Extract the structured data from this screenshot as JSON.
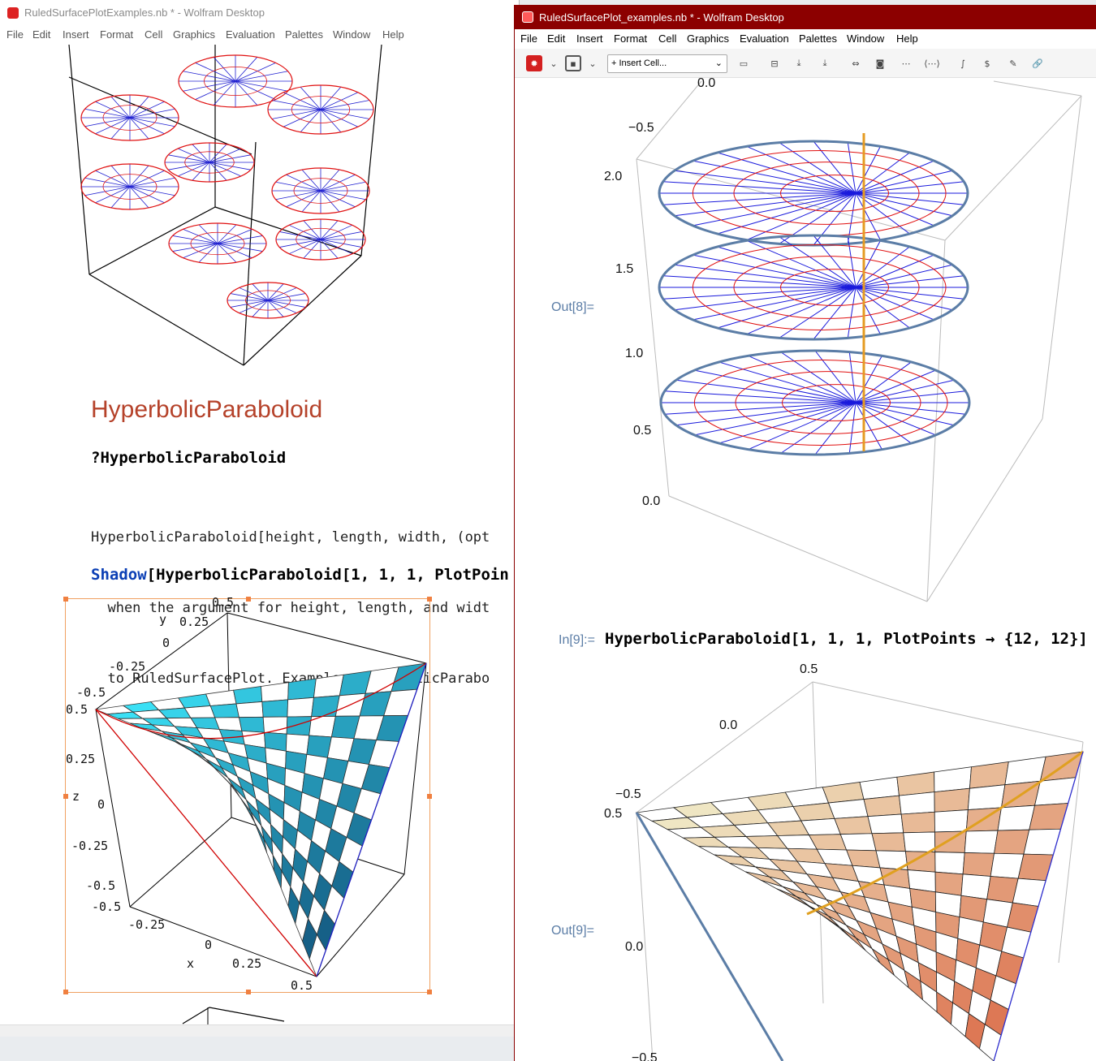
{
  "left_window": {
    "title": "RuledSurfacePlotExamples.nb * - Wolfram Desktop",
    "menu": [
      "File",
      "Edit",
      "Insert",
      "Format",
      "Cell",
      "Graphics",
      "Evaluation",
      "Palettes",
      "Window",
      "Help"
    ],
    "section_title": "HyperbolicParaboloid",
    "query_input": "?HyperbolicParaboloid",
    "usage_lines": [
      "HyperbolicParaboloid[height, length, width, (opt",
      "  when the argument for height, length, and widt",
      "  to RuledSurfacePlot. Example: HyperbolicParabo"
    ],
    "shadow_input": {
      "head": "Shadow",
      "rest": "[HyperbolicParaboloid[1, 1, 1, PlotPoin"
    },
    "shadow_plot": {
      "y_axis": {
        "label": "y",
        "ticks": [
          "0.5",
          "0.25",
          "0",
          "-0.25",
          "-0.5"
        ]
      },
      "z_axis": {
        "label": "z",
        "ticks": [
          "0.5",
          "0.25",
          "0",
          "-0.25",
          "-0.5"
        ]
      },
      "x_axis": {
        "label": "x",
        "ticks": [
          "-0.5",
          "-0.25",
          "0",
          "0.25",
          "0.5"
        ]
      }
    }
  },
  "right_window": {
    "title": "RuledSurfacePlot_examples.nb * - Wolfram Desktop",
    "menu": [
      "File",
      "Edit",
      "Insert",
      "Format",
      "Cell",
      "Graphics",
      "Evaluation",
      "Palettes",
      "Window",
      "Help"
    ],
    "toolbar": {
      "insert_cell": "+ Insert Cell..."
    },
    "out8_label": "Out[8]=",
    "helix_plot": {
      "ticks": [
        "0.0",
        "−0.5",
        "2.0",
        "1.5",
        "1.0",
        "0.5",
        "0.0"
      ]
    },
    "in9_label": "In[9]:=",
    "in9_code": "HyperbolicParaboloid[1, 1, 1, PlotPoints → {12, 12}]",
    "out9_label": "Out[9]=",
    "paraboloid_plot": {
      "ticks": [
        "0.5",
        "0.0",
        "−0.5",
        "0.5",
        "0.0",
        "−0.5"
      ]
    }
  },
  "colors": {
    "right_titlebar": "#8c0000",
    "section_title": "#b5422a",
    "cell_label": "#5b7da6",
    "keyword_blue": "#0b3fb5"
  }
}
